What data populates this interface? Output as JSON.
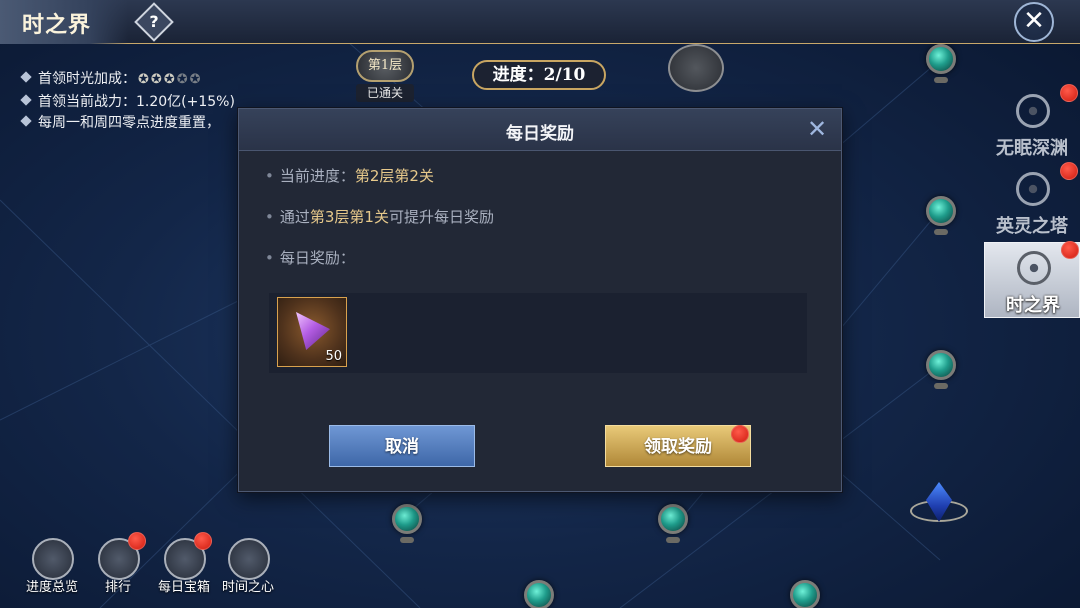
{
  "header": {
    "title": "时之界",
    "help_icon": "?",
    "close_icon": "✕"
  },
  "info": {
    "line1_label": "首领时光加成：",
    "stars_filled": 3,
    "stars_total": 5,
    "line2": "首领当前战力：1.20亿(+15%)",
    "line3": "每周一和周四零点进度重置，"
  },
  "stage": {
    "layer_badge": "第1层",
    "cleared_label": "已通关",
    "progress_text": "进度：2/10"
  },
  "side_tabs": [
    {
      "label": "无眠深渊",
      "icon": "spiral-icon",
      "badge": true
    },
    {
      "label": "英灵之塔",
      "icon": "tower-icon",
      "badge": true
    },
    {
      "label": "时之界",
      "icon": "spiral-icon",
      "badge": true,
      "active": true
    }
  ],
  "bottom_buttons": [
    {
      "label": "进度总览",
      "icon": "scroll-icon",
      "badge": false
    },
    {
      "label": "排行",
      "icon": "ranking-icon",
      "badge": true
    },
    {
      "label": "每日宝箱",
      "icon": "chest-icon",
      "badge": true
    },
    {
      "label": "时间之心",
      "icon": "clock-gear-icon",
      "badge": false
    }
  ],
  "modal": {
    "title": "每日奖励",
    "current_progress_label": "当前进度：",
    "current_progress_value": "第2层第2关",
    "tip_prefix": "通过",
    "tip_target": "第3层第1关",
    "tip_suffix": "可提升每日奖励",
    "daily_reward_label": "每日奖励：",
    "reward_item": {
      "icon": "purple-gem-icon",
      "count": "50"
    },
    "cancel_label": "取消",
    "claim_label": "领取奖励"
  }
}
